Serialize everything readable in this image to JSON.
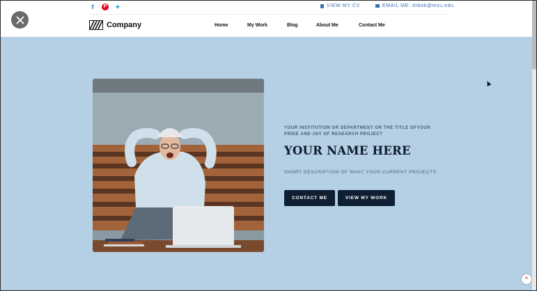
{
  "topbar": {
    "social": [
      {
        "icon": "facebook-icon",
        "glyph": "f"
      },
      {
        "icon": "pinterest-icon",
        "glyph": "P"
      },
      {
        "icon": "twitter-icon",
        "glyph": "✦"
      }
    ],
    "cv_link": "VIEW MY CV",
    "email_link": "EMAIL ME: drbob@msu.edu"
  },
  "nav": {
    "brand": "Company",
    "items": [
      "Home",
      "My Work",
      "Blog",
      "About Me",
      "Contact Me"
    ]
  },
  "hero": {
    "eyebrow": "YOUR INSTITUTION OR DEPARTMENT OR THE TITLE OFYOUR PRIDE AND JOY OF RESEARCH PROJECT",
    "name": "YOUR NAME HERE",
    "description": "SHORT DESCRIPTION OF WHAT YOUR CURRENT PROJECTS",
    "buttons": {
      "contact": "CONTACT ME",
      "work": "VIEW MY WORK"
    },
    "background": "#b5cfe5",
    "button_color": "#0e1f33"
  },
  "colors": {
    "link": "#3a6fb5",
    "text_dark": "#0f1a2b"
  }
}
